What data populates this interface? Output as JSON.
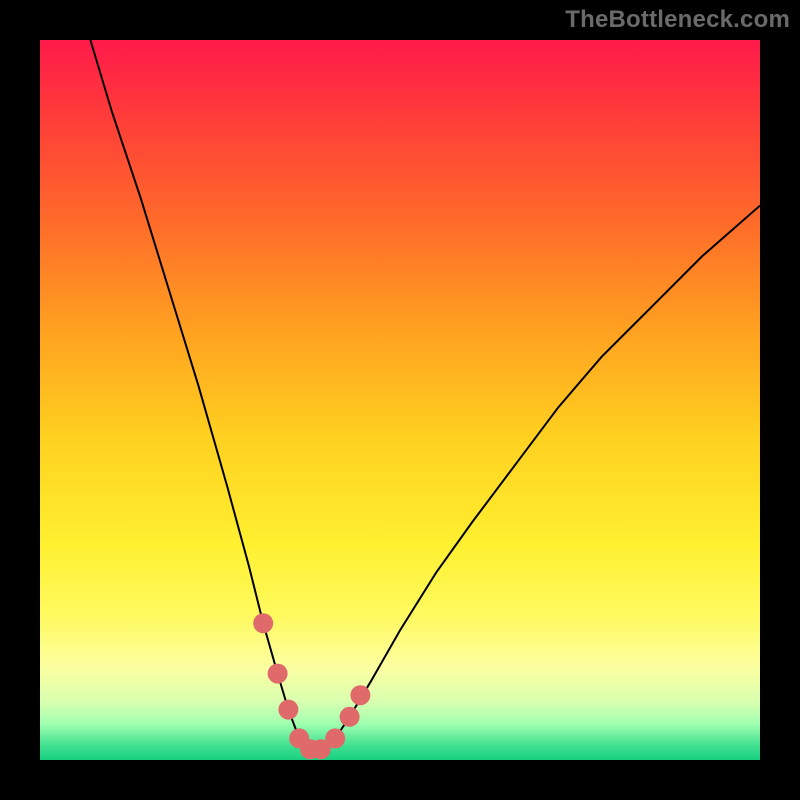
{
  "attribution": "TheBottleneck.com",
  "chart_data": {
    "type": "line",
    "title": "",
    "xlabel": "",
    "ylabel": "",
    "xlim": [
      0,
      100
    ],
    "ylim": [
      0,
      100
    ],
    "x": [
      7,
      10,
      14,
      18,
      22,
      26,
      29,
      31,
      33,
      34.5,
      36,
      37.5,
      39,
      41,
      43,
      46,
      50,
      55,
      60,
      66,
      72,
      78,
      85,
      92,
      100
    ],
    "values": [
      100,
      90,
      78,
      65,
      52,
      38,
      27,
      19,
      12,
      7,
      3,
      1.5,
      1.5,
      3,
      6,
      11,
      18,
      26,
      33,
      41,
      49,
      56,
      63,
      70,
      77
    ],
    "highlights_x": [
      31,
      33,
      34.5,
      36,
      37.5,
      39,
      41,
      43,
      44.5
    ],
    "highlights_y": [
      19,
      12,
      7,
      3,
      1.5,
      1.5,
      3,
      6,
      9
    ]
  },
  "colors": {
    "curve": "#000000",
    "highlight": "#e06a6a"
  }
}
